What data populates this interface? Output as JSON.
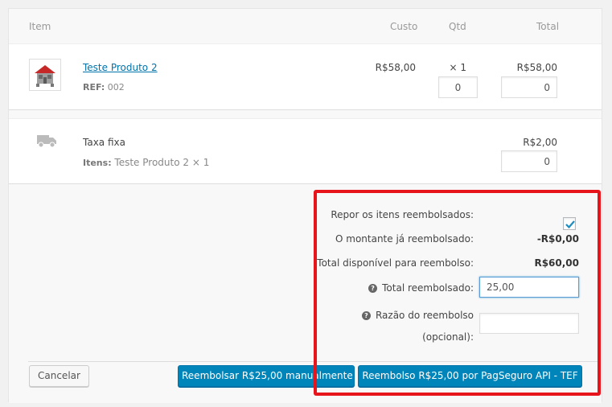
{
  "headers": {
    "item": "Item",
    "cost": "Custo",
    "qty": "Qtd",
    "total": "Total"
  },
  "product": {
    "name": "Teste Produto 2",
    "ref_label": "REF:",
    "ref_value": "002",
    "cost": "R$58,00",
    "qty": "× 1",
    "total": "R$58,00",
    "refund_qty_value": "0",
    "refund_total_value": "0",
    "thumbnail_icon": "house-product-image"
  },
  "shipping": {
    "icon": "truck-icon",
    "name": "Taxa fixa",
    "items_label": "Itens:",
    "items_value": "Teste Produto 2 × 1",
    "total": "R$2,00",
    "refund_total_value": "0"
  },
  "refund": {
    "restock_label": "Repor os itens reembolsados:",
    "restock_checked": true,
    "already_refunded_label": "O montante já reembolsado:",
    "already_refunded_value": "-R$0,00",
    "available_label": "Total disponível para reembolso:",
    "available_value": "R$60,00",
    "amount_label": "Total reembolsado:",
    "amount_value": "25,00",
    "reason_label_1": "Razão do reembolso",
    "reason_label_2": "(opcional):",
    "reason_value": ""
  },
  "actions": {
    "cancel": "Cancelar",
    "manual": "Reembolsar R$25,00 manualmente",
    "api": "Reembolso R$25,00 por PagSeguro API - TEF"
  },
  "colors": {
    "primary": "#0085ba",
    "link": "#0073aa",
    "highlight": "#e8141c"
  }
}
